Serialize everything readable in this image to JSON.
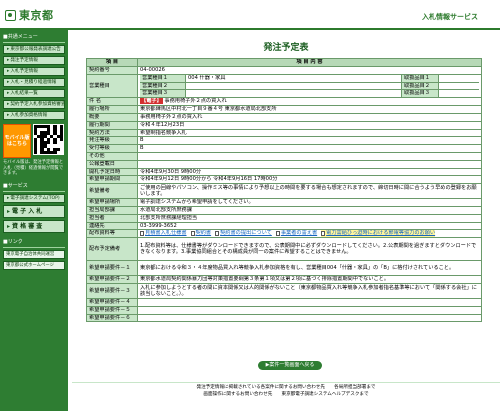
{
  "header": {
    "logo_text": "東京都",
    "service_name": "入札情報サービス"
  },
  "sidebar": {
    "menu_heading": "■共通メニュー",
    "menu_items": [
      "東京都公報発表調達公告",
      "発注予定情報",
      "入札予定情報",
      "入札・見積り経過情報",
      "入札結果一覧",
      "契約予定入札参加資格審査",
      "入札参加資格情報"
    ],
    "mobile_badge": "モバイル版はこちら",
    "mobile_note": "モバイル版は、発注予定情報と入札（見積）経過情報が閲覧できます。",
    "service_heading": "■サービス",
    "service_link": "電子調達システム(TOP)",
    "big_buttons": [
      "電 子 入 札",
      "資 格 審 査"
    ],
    "links_heading": "■リンク",
    "links": [
      "東京電子自治体共同運営",
      "東京都公式ホームページ"
    ]
  },
  "main": {
    "title": "発注予定表",
    "header_item": "項 目",
    "header_content": "項 目 内 容",
    "rows": {
      "keiyaku_no": {
        "label": "契約番号",
        "value": "04-00026"
      },
      "eigyo": {
        "label": "営業種目",
        "lines": [
          {
            "sub": "営業種目１",
            "value": "004 什器・家具",
            "key": "取扱品目１"
          },
          {
            "sub": "営業種目２",
            "value": "",
            "key": "取扱品目２"
          },
          {
            "sub": "営業種目３",
            "value": "",
            "key": "取扱品目３"
          }
        ]
      },
      "kenmei": {
        "label": "件 名",
        "badge": "【電子】",
        "value": "事務用椅子外２点の買入れ"
      },
      "place": {
        "label": "履行場所",
        "value": "東京都練馬区中村北一丁目９番４号 東京都水道局北部支所"
      },
      "gaiyo": {
        "label": "概要",
        "value": "事務用椅子外２点の買入れ"
      },
      "date": {
        "label": "履行期間",
        "value": "令和４年12月23日"
      },
      "hoshiki": {
        "label": "契約方法",
        "value": "希望制指名競争入札"
      },
      "hatchu": {
        "label": "発注等級",
        "value": "B"
      },
      "juchu": {
        "label": "受付等級",
        "value": "B"
      },
      "sonota": {
        "label": "その他",
        "value": ""
      },
      "koho": {
        "label": "公報登載日",
        "value": ""
      },
      "kaishi": {
        "label": "開札予定日時",
        "value": "令和4年9月30日 9時00分"
      },
      "kibou_kikan": {
        "label": "希望申請期間",
        "value": "令和4年9月12日 9時00分から 令和4年9月16日 17時00分"
      },
      "kibou_jikou": {
        "label": "希望備考",
        "value": "ご使用の回線やパソコン、操作ミス等の事情により予想以上の時間を要する場合も想定されますので、締切日時に間に合うよう早めの登録をお願いします。"
      },
      "tetsuzuki": {
        "label": "希望申請場所",
        "value": "電子調達システムから希望申請をしてください。"
      },
      "tantoka": {
        "label": "担当局部課",
        "value": "水道局北部支所庶務課"
      },
      "tantosha": {
        "label": "担当者",
        "value": "北部支所庶務課経理担当"
      },
      "renraku": {
        "label": "連絡先",
        "value": "03-3999-3652"
      },
      "haifu": {
        "label": "配布資料等",
        "files": [
          "見積書入札仕様書",
          "契約書",
          "契約書の提出について",
          "事業者の誓え書",
          "電力需給ひっ迫時における節電等協力のお願い"
        ]
      },
      "haifu_biko": {
        "label": "配布予定備考",
        "value": "1.配布資料等は、仕様書等がダウンロードできますので、公表期間中に必ずダウンロードしてください。2.公表期間を過ぎますとダウンロードできなくなります。3.事業協同組合とその構成員が同一の案件に希望することはできません。"
      },
      "joken1": {
        "label": "希望申請要件－１",
        "value": "東京都における令和３・４年度物品買入れ等競争入札参加資格を有し、営業種目004「什器・家具」の「B」に格付けされていること。"
      },
      "joken2": {
        "label": "希望申請要件－２",
        "value": "東京都水道局契約関係暴力団等対策措置要綱第３条第１項又は第２項に基づく排除措置期間中でないこと。"
      },
      "joken3": {
        "label": "希望申請要件－３",
        "value": "入札に参加しようとする者の間に資本関係又は人的関係がないこと（東京都物品買入れ等競争入札参加者指名基準等において「関係する会社」に該当しないこと。）。"
      },
      "joken4": {
        "label": "希望申請要件－４",
        "value": ""
      },
      "joken5": {
        "label": "希望申請要件－５",
        "value": ""
      },
      "joken6": {
        "label": "希望申請要件－６",
        "value": ""
      }
    },
    "back_button": "▶案件一覧画面へ戻る"
  },
  "footer": {
    "line1": "発注予定情報に掲載されている各案件に関するお問い合わせ先　　各局所担当部署まで",
    "line2": "画面操作に関するお問い合わせ先　　東京都電子調達システムヘルプデスクまで"
  },
  "colors": {
    "brand_green": "#2e7d32",
    "label_bg": "#c8e6c9",
    "badge_red": "#d32f2f",
    "link_blue": "#1565c0"
  }
}
